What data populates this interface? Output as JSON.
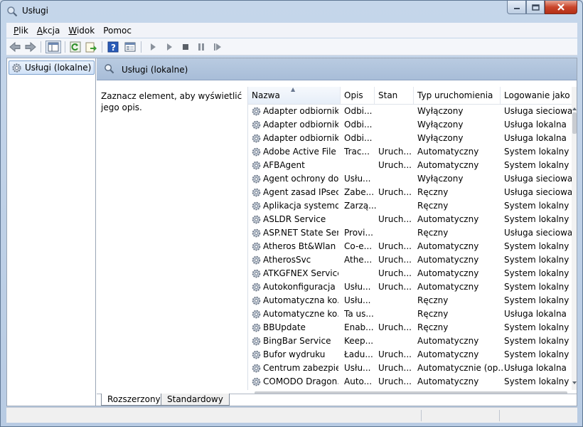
{
  "window": {
    "title": "Usługi"
  },
  "menu": [
    {
      "label": "Plik",
      "key": "P",
      "rest": "lik"
    },
    {
      "label": "Akcja",
      "key": "A",
      "rest": "kcja"
    },
    {
      "label": "Widok",
      "key": "W",
      "rest": "idok"
    },
    {
      "label": "Pomoc",
      "key": "",
      "rest": "Pomoc"
    }
  ],
  "toolbar": {
    "icons": [
      "back-icon",
      "forward-icon",
      "show-hide-tree-icon",
      "refresh-icon",
      "export-list-icon",
      "help-icon",
      "properties-icon",
      "start-icon",
      "start-alt-icon",
      "stop-icon",
      "pause-icon",
      "restart-icon"
    ]
  },
  "tree": {
    "root_label": "Usługi (lokalne)"
  },
  "pane": {
    "title": "Usługi (lokalne)",
    "description": "Zaznacz element, aby wyświetlić jego opis."
  },
  "columns": [
    "Nazwa",
    "Opis",
    "Stan",
    "Typ uruchomienia",
    "Logowanie jako"
  ],
  "services": [
    [
      "Adapter odbiornik...",
      "Odbi...",
      "",
      "Wyłączony",
      "Usługa sieciowa"
    ],
    [
      "Adapter odbiornik...",
      "Odbi...",
      "",
      "Wyłączony",
      "Usługa lokalna"
    ],
    [
      "Adapter odbiornik...",
      "Odbi...",
      "",
      "Wyłączony",
      "Usługa lokalna"
    ],
    [
      "Adobe Active File ...",
      "Trac...",
      "Uruch...",
      "Automatyczny",
      "System lokalny"
    ],
    [
      "AFBAgent",
      "",
      "Uruch...",
      "Automatyczny",
      "System lokalny"
    ],
    [
      "Agent ochrony do...",
      "Usłu...",
      "",
      "Wyłączony",
      "Usługa sieciowa"
    ],
    [
      "Agent zasad IPsec",
      "Zabe...",
      "Uruch...",
      "Ręczny",
      "Usługa sieciowa"
    ],
    [
      "Aplikacja systemo...",
      "Zarzą...",
      "",
      "Ręczny",
      "System lokalny"
    ],
    [
      "ASLDR Service",
      "",
      "Uruch...",
      "Automatyczny",
      "System lokalny"
    ],
    [
      "ASP.NET State Ser...",
      "Provi...",
      "",
      "Ręczny",
      "Usługa sieciowa"
    ],
    [
      "Atheros Bt&Wlan ...",
      "Co-e...",
      "Uruch...",
      "Automatyczny",
      "System lokalny"
    ],
    [
      "AtherosSvc",
      "Athe...",
      "Uruch...",
      "Automatyczny",
      "System lokalny"
    ],
    [
      "ATKGFNEX Service",
      "",
      "Uruch...",
      "Automatyczny",
      "System lokalny"
    ],
    [
      "Autokonfiguracja ...",
      "Usłu...",
      "Uruch...",
      "Automatyczny",
      "System lokalny"
    ],
    [
      "Automatyczna ko...",
      "Usłu...",
      "",
      "Ręczny",
      "System lokalny"
    ],
    [
      "Automatyczne ko...",
      "Ta us...",
      "",
      "Ręczny",
      "Usługa lokalna"
    ],
    [
      "BBUpdate",
      "Enab...",
      "Uruch...",
      "Ręczny",
      "System lokalny"
    ],
    [
      "BingBar Service",
      "Keep...",
      "",
      "Automatyczny",
      "System lokalny"
    ],
    [
      "Bufor wydruku",
      "Ładu...",
      "Uruch...",
      "Automatyczny",
      "System lokalny"
    ],
    [
      "Centrum zabezpie...",
      "Usłu...",
      "Uruch...",
      "Automatycznie (op...",
      "Usługa lokalna"
    ],
    [
      "COMODO Dragon...",
      "Auto...",
      "Uruch...",
      "Automatyczny",
      "System lokalny"
    ]
  ],
  "tabs": [
    "Rozszerzony",
    "Standardowy"
  ]
}
